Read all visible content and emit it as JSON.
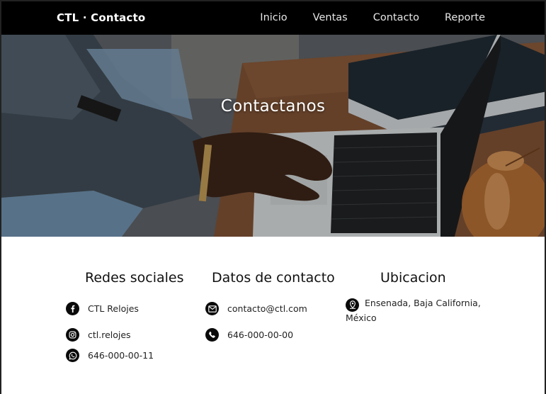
{
  "navbar": {
    "brand": "CTL · Contacto",
    "links": [
      "Inicio",
      "Ventas",
      "Contacto",
      "Reporte"
    ]
  },
  "hero": {
    "title": "Contactanos"
  },
  "social": {
    "heading": "Redes sociales",
    "items": [
      {
        "icon": "facebook-icon",
        "text": "CTL Relojes"
      },
      {
        "icon": "instagram-icon",
        "text": "ctl.relojes"
      },
      {
        "icon": "whatsapp-icon",
        "text": "646-000-00-11"
      }
    ]
  },
  "contact": {
    "heading": "Datos de contacto",
    "items": [
      {
        "icon": "mail-icon",
        "text": "contacto@ctl.com"
      },
      {
        "icon": "phone-icon",
        "text": "646-000-00-00"
      }
    ]
  },
  "location": {
    "heading": "Ubicacion",
    "icon": "map-pin-icon",
    "text": "Ensenada, Baja California, México"
  }
}
